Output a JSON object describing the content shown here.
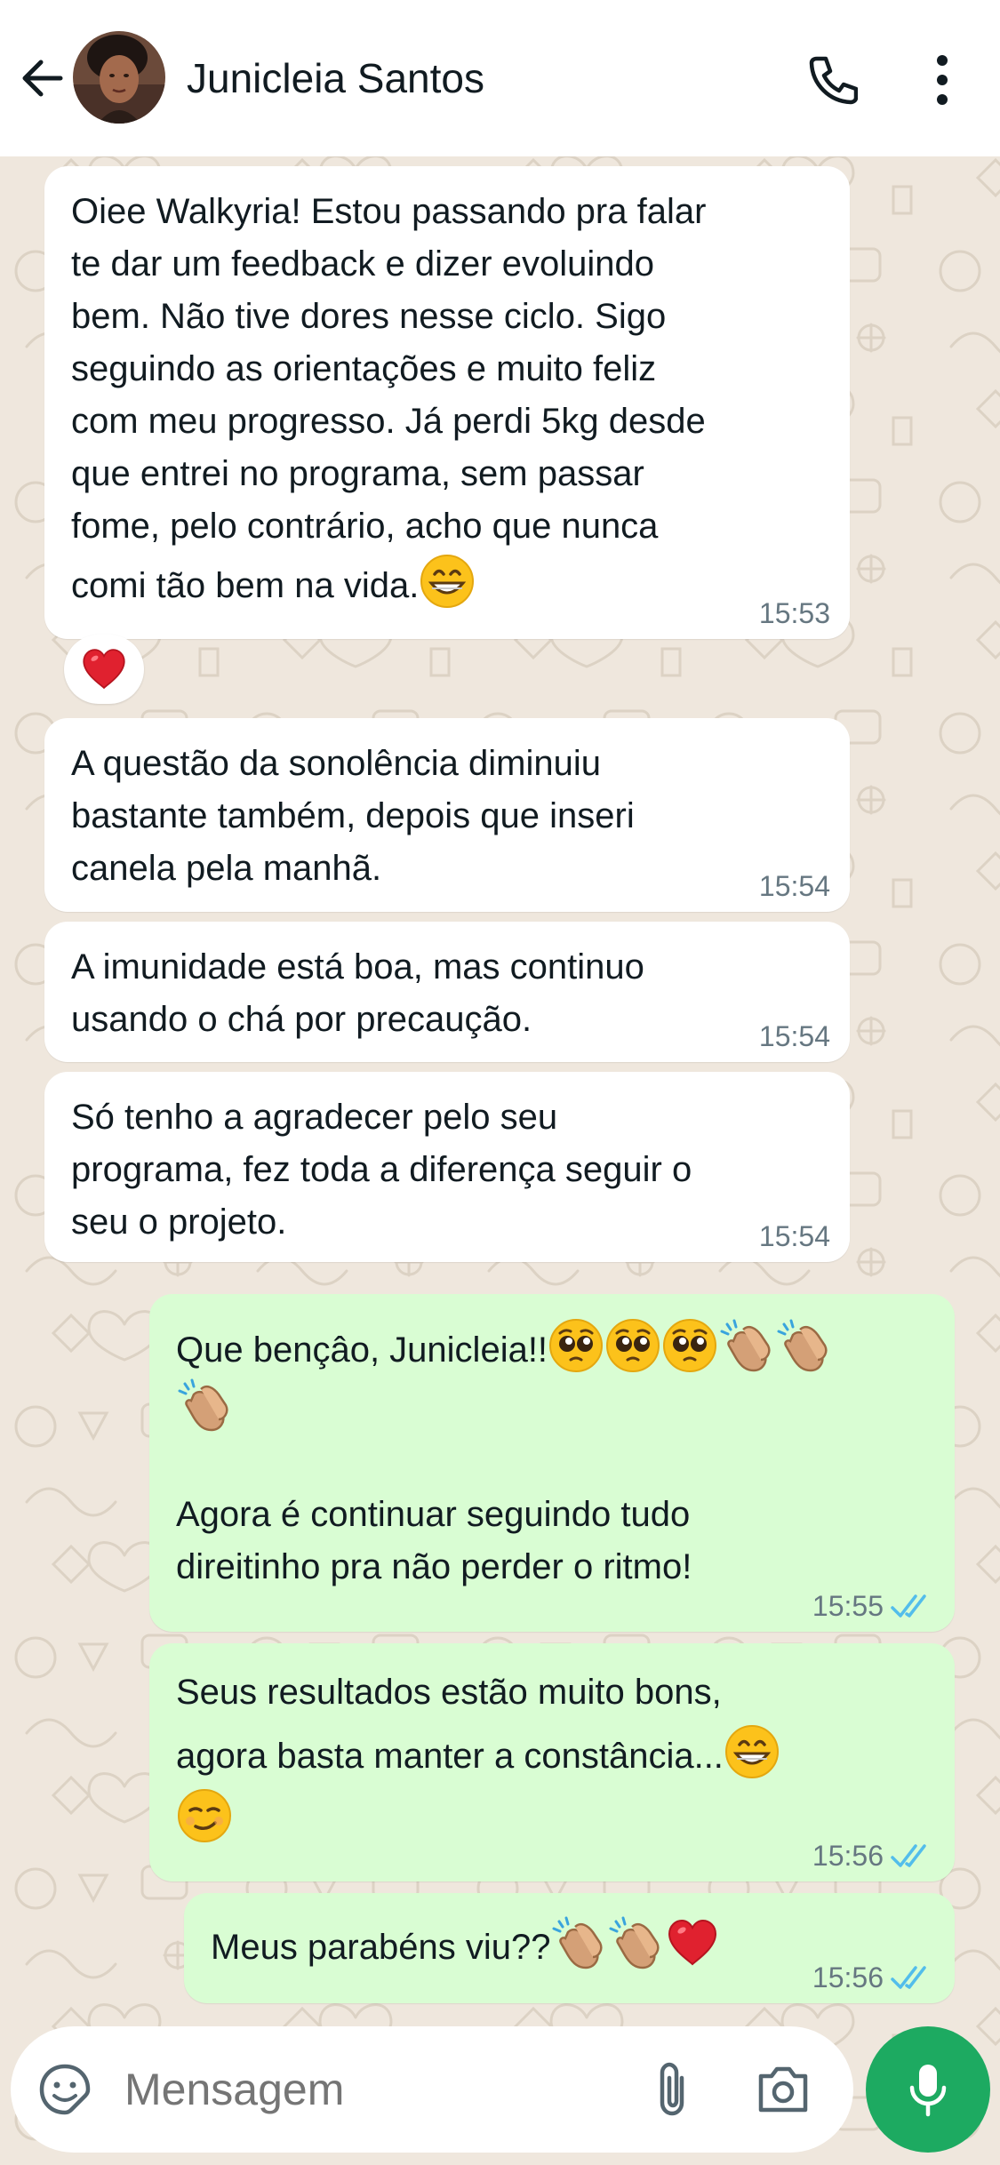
{
  "header": {
    "contact_name": "Junicleia Santos",
    "back_icon": "arrow-left-icon",
    "call_icon": "phone-icon",
    "menu_icon": "more-vertical-icon"
  },
  "messages": [
    {
      "direction": "incoming",
      "text": "Oiee Walkyria! Estou passando pra falar\nte dar um feedback e dizer evoluindo\nbem. Não tive dores nesse ciclo. Sigo\nseguindo as orientações e muito feliz\ncom meu progresso. Já perdi 5kg desde\nque entrei no programa, sem passar\nfome, pelo contrário, acho que nunca\ncomi tão bem na vida.",
      "trailing_emojis": [
        "grinning-face"
      ],
      "time": "15:53",
      "reaction": "red-heart"
    },
    {
      "direction": "incoming",
      "text": "A questão da sonolência diminuiu\nbastante também, depois que inseri\ncanela pela manhã.",
      "time": "15:54"
    },
    {
      "direction": "incoming",
      "text": "A imunidade está boa, mas continuo\nusando o chá por precaução.",
      "time": "15:54"
    },
    {
      "direction": "incoming",
      "text": "Só tenho a agradecer pelo seu\nprograma, fez toda a diferença seguir o\nseu o projeto.",
      "time": "15:54"
    },
    {
      "direction": "outgoing",
      "text_line1": "Que bençâo, Junicleia!!",
      "line1_emojis": [
        "pleading-face",
        "pleading-face",
        "pleading-face",
        "clapping-hands",
        "clapping-hands"
      ],
      "line2_emojis": [
        "clapping-hands"
      ],
      "text_after": "Agora é continuar seguindo tudo\ndireitinho pra não perder o ritmo!",
      "time": "15:55",
      "status": "read"
    },
    {
      "direction": "outgoing",
      "text_line1": "Seus resultados estão muito bons,",
      "text_line2": "agora basta manter a constância...",
      "line2_emojis": [
        "grinning-face"
      ],
      "line3_emojis": [
        "smirking-face"
      ],
      "time": "15:56",
      "status": "read"
    },
    {
      "direction": "outgoing",
      "text": "Meus parabéns viu??",
      "trailing_emojis": [
        "clapping-hands",
        "clapping-hands",
        "red-heart"
      ],
      "time": "15:56",
      "status": "read"
    }
  ],
  "composer": {
    "placeholder": "Mensagem",
    "emoji_icon": "sticker-smiley-icon",
    "attach_icon": "paperclip-icon",
    "camera_icon": "camera-icon",
    "mic_icon": "microphone-icon"
  },
  "colors": {
    "incoming_bubble": "#ffffff",
    "outgoing_bubble": "#d9fdd3",
    "read_ticks": "#53bdeb",
    "mic_button": "#1daa61",
    "wallpaper": "#efe7dd"
  }
}
